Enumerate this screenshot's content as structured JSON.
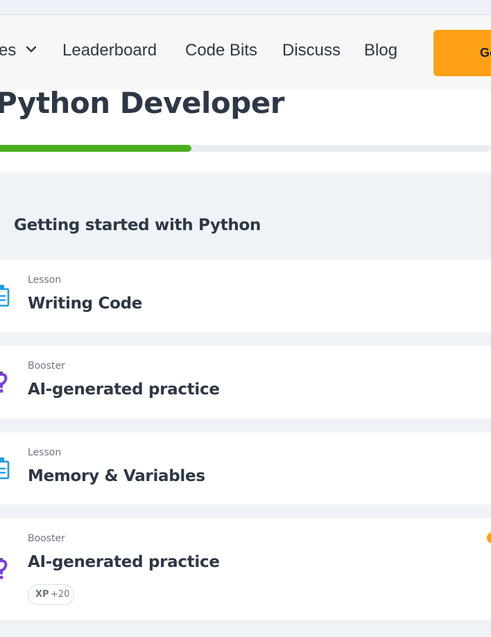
{
  "nav": {
    "items": [
      {
        "label": "es",
        "has_chevron": true
      },
      {
        "label": "Leaderboard"
      },
      {
        "label": "Code Bits"
      },
      {
        "label": "Discuss"
      },
      {
        "label": "Blog"
      }
    ],
    "cta_label": "Go",
    "cta_color": "#ffa116"
  },
  "course": {
    "title": "Python Developer",
    "progress_fraction": 0.39
  },
  "module": {
    "title": "Getting started with Python",
    "items": [
      {
        "type": "Lesson",
        "title": "Writing Code",
        "icon": "lesson-book-icon"
      },
      {
        "type": "Booster",
        "title": "AI-generated practice",
        "icon": "question-mark-icon"
      },
      {
        "type": "Lesson",
        "title": "Memory & Variables",
        "icon": "lesson-book-icon"
      },
      {
        "type": "Booster",
        "title": "AI-generated practice",
        "icon": "question-mark-icon",
        "xp_label": "XP",
        "xp_value": "+20"
      }
    ]
  },
  "colors": {
    "accent": "#ffa116",
    "progress": "#4caf1e",
    "lesson_icon": "#1e9ce6",
    "booster_icon": "#7b3fe0"
  }
}
